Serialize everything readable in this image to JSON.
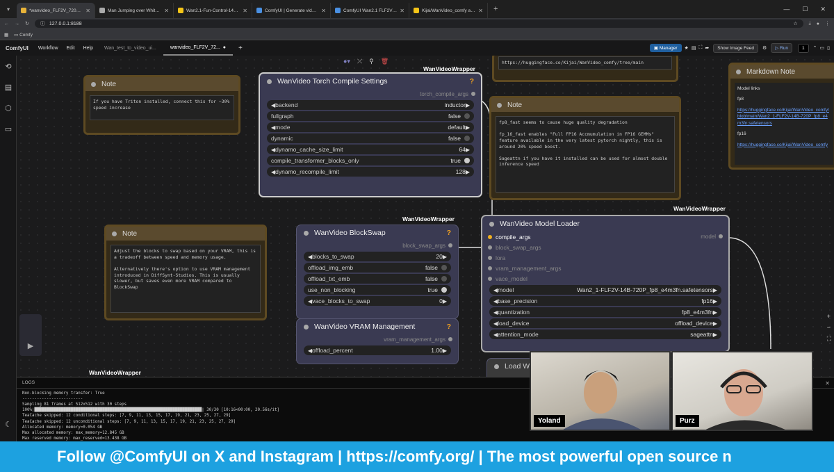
{
  "browser": {
    "tabs": [
      {
        "title": "*wanvideo_FLF2V_720P_example",
        "color": "#e8b339",
        "active": true
      },
      {
        "title": "Man Jumping over White Fence",
        "color": "#aaaaaa",
        "active": false
      },
      {
        "title": "Wan2.1-Fun-Control-14B_fp8_e4m3fn",
        "color": "#f5c518",
        "active": false
      },
      {
        "title": "ComfyUI | Generate video, images",
        "color": "#4a90e2",
        "active": false
      },
      {
        "title": "ComfyUI Wan2.1 FLF2V & Wan",
        "color": "#4a90e2",
        "active": false
      },
      {
        "title": "Kijai/WanVideo_comfy at main",
        "color": "#f5c518",
        "active": false
      }
    ],
    "url": "127.0.0.1:8188",
    "bookmark": "Comfy"
  },
  "menu": {
    "logo": "ComfyUI",
    "items": [
      "Workflow",
      "Edit",
      "Help"
    ],
    "workflow_tabs": [
      {
        "label": "Wan_test_to_video_ui...",
        "active": false
      },
      {
        "label": "wanvideo_FLF2V_72...",
        "active": true
      }
    ],
    "manager": "Manager",
    "show_image_feed": "Show Image Feed",
    "run": "Run",
    "batch": "1"
  },
  "nodes": {
    "note1": {
      "title": "Note",
      "text": "If you have Triton installed, connect this for ~30% speed increase"
    },
    "note2": {
      "title": "Note",
      "text": "Adjust the blocks to swap based on your VRAM, this is a tradeoff between speed and memory usage.\n\nAlternatively there's option to use VRAM management introduced in DiffSynt-Studios. This is usually slower, but saves even more VRAM compared to BlockSwap"
    },
    "note3": {
      "title": "Note",
      "text": "fp8_fast seems to cause huge quality degradation\n\nfp_16_fast enables \"Full FP16 Accmumulation in FP16 GEMMs\" feature available in the very latest pytorch nightly, this is around 20% speed boost.\n\nSageattn if you have it installed can be used for almost double inference speed"
    },
    "note_top": {
      "text": "https://huggingface.co/Kijai/WanVideo_comfy/tree/main"
    },
    "torch": {
      "group": "WanVideoWrapper",
      "title": "WanVideo Torch Compile Settings",
      "output": "torch_compile_args",
      "widgets": [
        {
          "label": "backend",
          "value": "inductor",
          "type": "combo"
        },
        {
          "label": "fullgraph",
          "value": "false",
          "type": "toggle",
          "on": false
        },
        {
          "label": "mode",
          "value": "default",
          "type": "combo"
        },
        {
          "label": "dynamic",
          "value": "false",
          "type": "toggle",
          "on": false
        },
        {
          "label": "dynamo_cache_size_limit",
          "value": "64",
          "type": "combo"
        },
        {
          "label": "compile_transformer_blocks_only",
          "value": "true",
          "type": "toggle",
          "on": true
        },
        {
          "label": "dynamo_recompile_limit",
          "value": "128",
          "type": "combo"
        }
      ]
    },
    "blockswap": {
      "group": "WanVideoWrapper",
      "title": "WanVideo BlockSwap",
      "output": "block_swap_args",
      "widgets": [
        {
          "label": "blocks_to_swap",
          "value": "20",
          "type": "combo"
        },
        {
          "label": "offload_img_emb",
          "value": "false",
          "type": "toggle",
          "on": false
        },
        {
          "label": "offload_txt_emb",
          "value": "false",
          "type": "toggle",
          "on": false
        },
        {
          "label": "use_non_blocking",
          "value": "true",
          "type": "toggle",
          "on": true
        },
        {
          "label": "vace_blocks_to_swap",
          "value": "0",
          "type": "combo"
        }
      ]
    },
    "vram": {
      "title": "WanVideo VRAM Management",
      "output": "vram_management_args",
      "widgets": [
        {
          "label": "offload_percent",
          "value": "1.00",
          "type": "combo"
        }
      ]
    },
    "loader": {
      "group": "WanVideoWrapper",
      "title": "WanVideo Model Loader",
      "inputs": [
        "compile_args",
        "block_swap_args",
        "lora",
        "vram_management_args",
        "vace_model"
      ],
      "output": "model",
      "widgets": [
        {
          "label": "model",
          "value": "Wan2_1-FLF2V-14B-720P_fp8_e4m3fn.safetensors"
        },
        {
          "label": "base_precision",
          "value": "fp16"
        },
        {
          "label": "quantization",
          "value": "fp8_e4m3fn"
        },
        {
          "label": "load_device",
          "value": "offload_device"
        },
        {
          "label": "attention_mode",
          "value": "sageattn"
        }
      ]
    },
    "md": {
      "title": "Markdown Note",
      "heading": "Model links",
      "l1": "fp8",
      "link1": "https://huggingface.co/Kijai/WanVideo_comfy/blob/main/Wan2_1-FLF2V-14B-720P_fp8_e4m3fn.safetensors",
      "l2": "fp16",
      "link2": "https://huggingface.co/Kijai/WanVideo_comfy"
    },
    "loadw": "Load W",
    "bottom_group": "WanVideoWrapper"
  },
  "logs": {
    "title": "LOGS",
    "lines": [
      "Non-blocking memory transfer: True",
      "-------------------------",
      "Sampling 81 frames at 512x512 with 30 steps",
      "100%|█████████████████████████████████████████████████████████████████████| 30/30 [10:16<00:00, 20.56s/it]",
      "TeaCache skipped: 12 conditional steps: [7, 9, 11, 13, 15, 17, 19, 21, 23, 25, 27, 29]",
      "TeaCache skipped: 12 unconditional steps: [7, 9, 11, 13, 15, 17, 19, 21, 23, 25, 27, 29]",
      "Allocated memory: memory=0.054 GB",
      "Max allocated memory: max_memory=12.845 GB",
      "Max reserved memory: max_reserved=13.438 GB"
    ]
  },
  "cams": [
    {
      "name": "Yoland"
    },
    {
      "name": "Purz"
    }
  ],
  "banner": "Follow @ComfyUI on X and Instagram | https://comfy.org/ | The most powerful open source n"
}
